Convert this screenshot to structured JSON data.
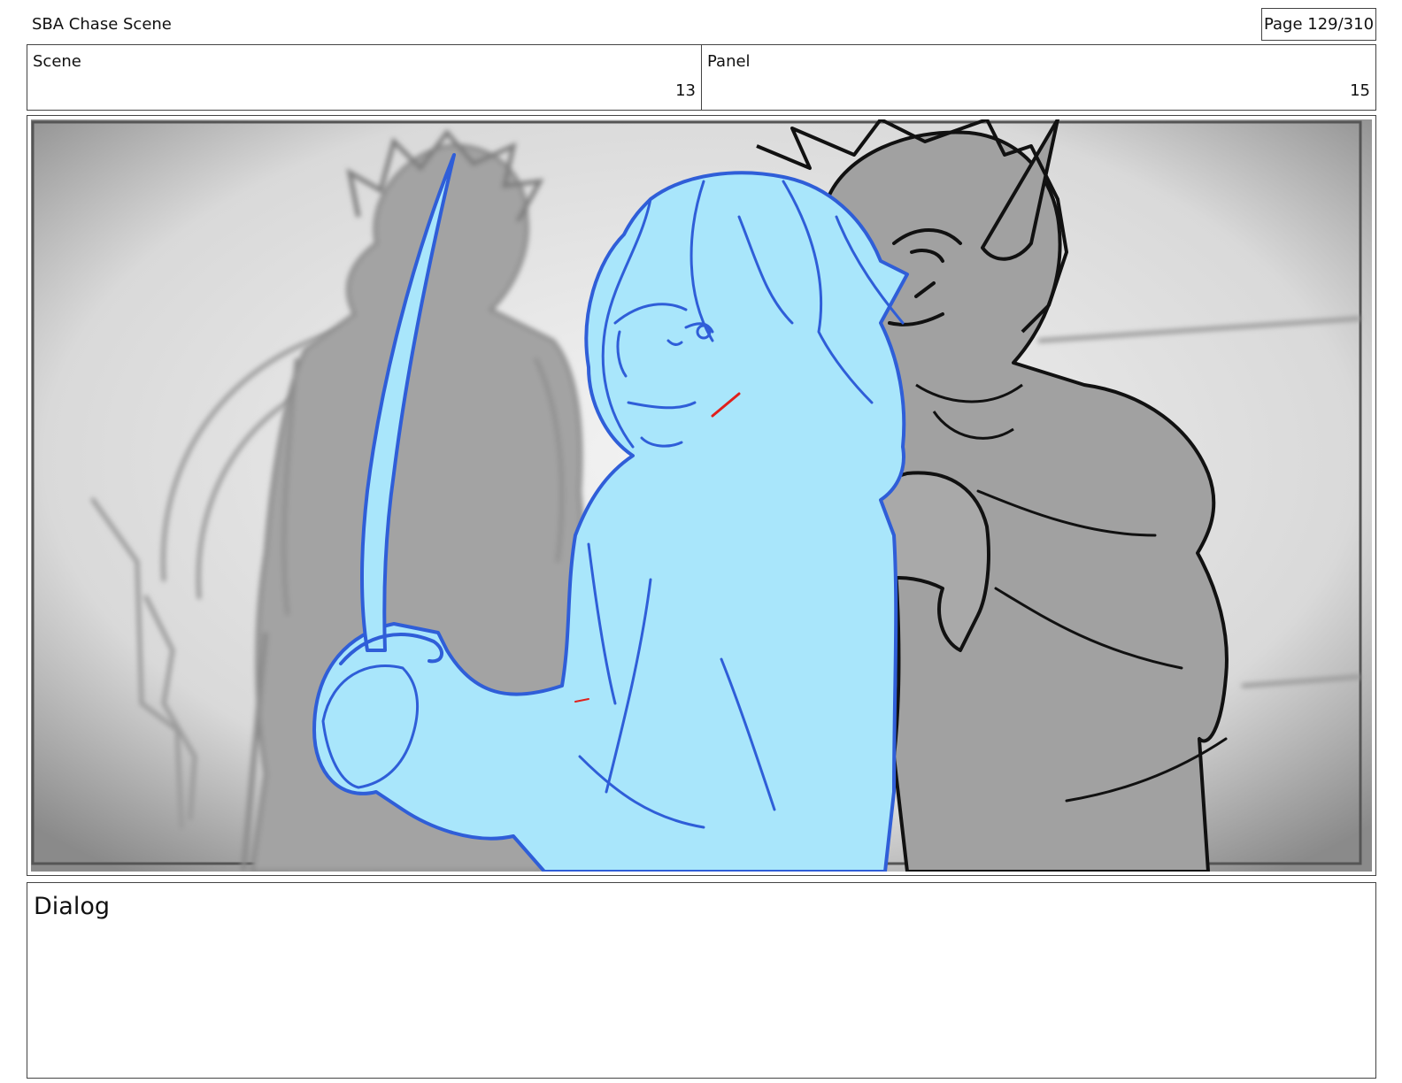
{
  "header": {
    "title": "SBA Chase Scene",
    "page": "Page 129/310"
  },
  "info": {
    "scene_label": "Scene",
    "scene_value": "13",
    "panel_label": "Panel",
    "panel_value": "15"
  },
  "dialog": {
    "label": "Dialog"
  },
  "colors": {
    "ink": "#111111",
    "rough_fill": "#9c9c9c",
    "character_fill": "#a9e6fb",
    "character_line": "#2f5ed8",
    "mark_red": "#e0201c"
  }
}
